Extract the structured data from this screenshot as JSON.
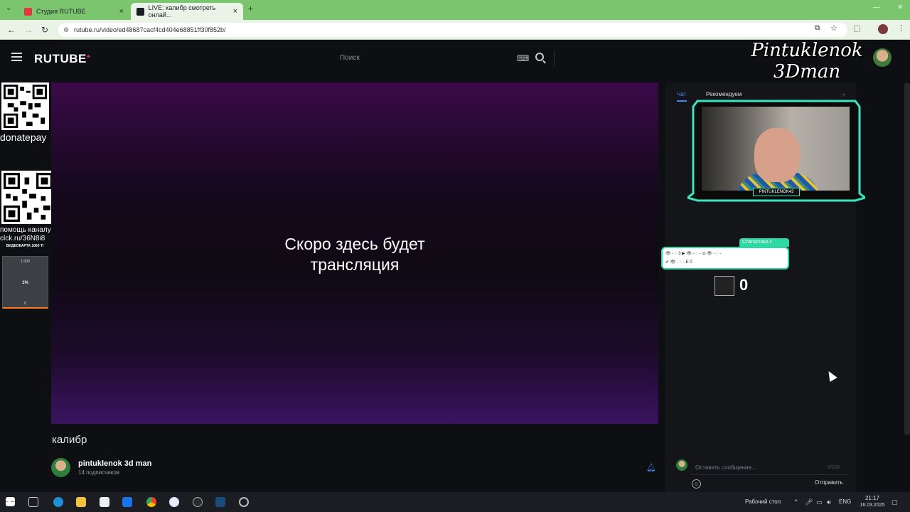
{
  "browser": {
    "tabs": [
      {
        "label": "Студия RUTUBE",
        "active": false
      },
      {
        "label": "LIVE: калибр смотреть онлай...",
        "active": true
      }
    ],
    "url": "rutube.ru/video/ed48687cacf4cd404e68851ff30f852b/"
  },
  "header": {
    "logo": "RUTUBE",
    "search_placeholder": "Поиск"
  },
  "overlay": {
    "streamer_name_line1": "Pintuklenok",
    "streamer_name_line2": "3Dman",
    "donatepay_label": "donatepay",
    "help_line1": "помощь каналу",
    "help_line2": "clck.ru/36N8i8",
    "goal_title": "ВИДЕОКАРТА 1060 TI",
    "goal_max": "1 000",
    "goal_percent": "1%",
    "goal_min": "0",
    "cam_nameplate": "PINTUKLENOK42",
    "stats_label": "Статистика",
    "stats_line1": "👁 - ◌ 3   ▶ 👁 - ◌ -   ◎ 👁 - ◌ -",
    "stats_line2": "✔ 👁 - ◌ -  E 0",
    "viewer_count": "0"
  },
  "player": {
    "message_line1": "Скоро здесь будет",
    "message_line2": "трансляция"
  },
  "video": {
    "title": "калибр",
    "channel_name": "pintuklenok 3d man",
    "subscribers": "14 подписчиков"
  },
  "chat": {
    "tab_chat": "Чат",
    "tab_recommended": "Рекомендуем",
    "input_placeholder": "Оставить сообщение...",
    "counter": "0/200",
    "send_label": "Отправить"
  },
  "taskbar": {
    "desktop_label": "Рабочий стол",
    "lang": "ENG",
    "time": "21:17",
    "date": "16.03.2025"
  },
  "colors": {
    "tabbar": "#7bc56e",
    "accent_blue": "#4a7dff",
    "overlay_teal": "#2fd9a2",
    "rutube_red": "#ff2d55"
  }
}
